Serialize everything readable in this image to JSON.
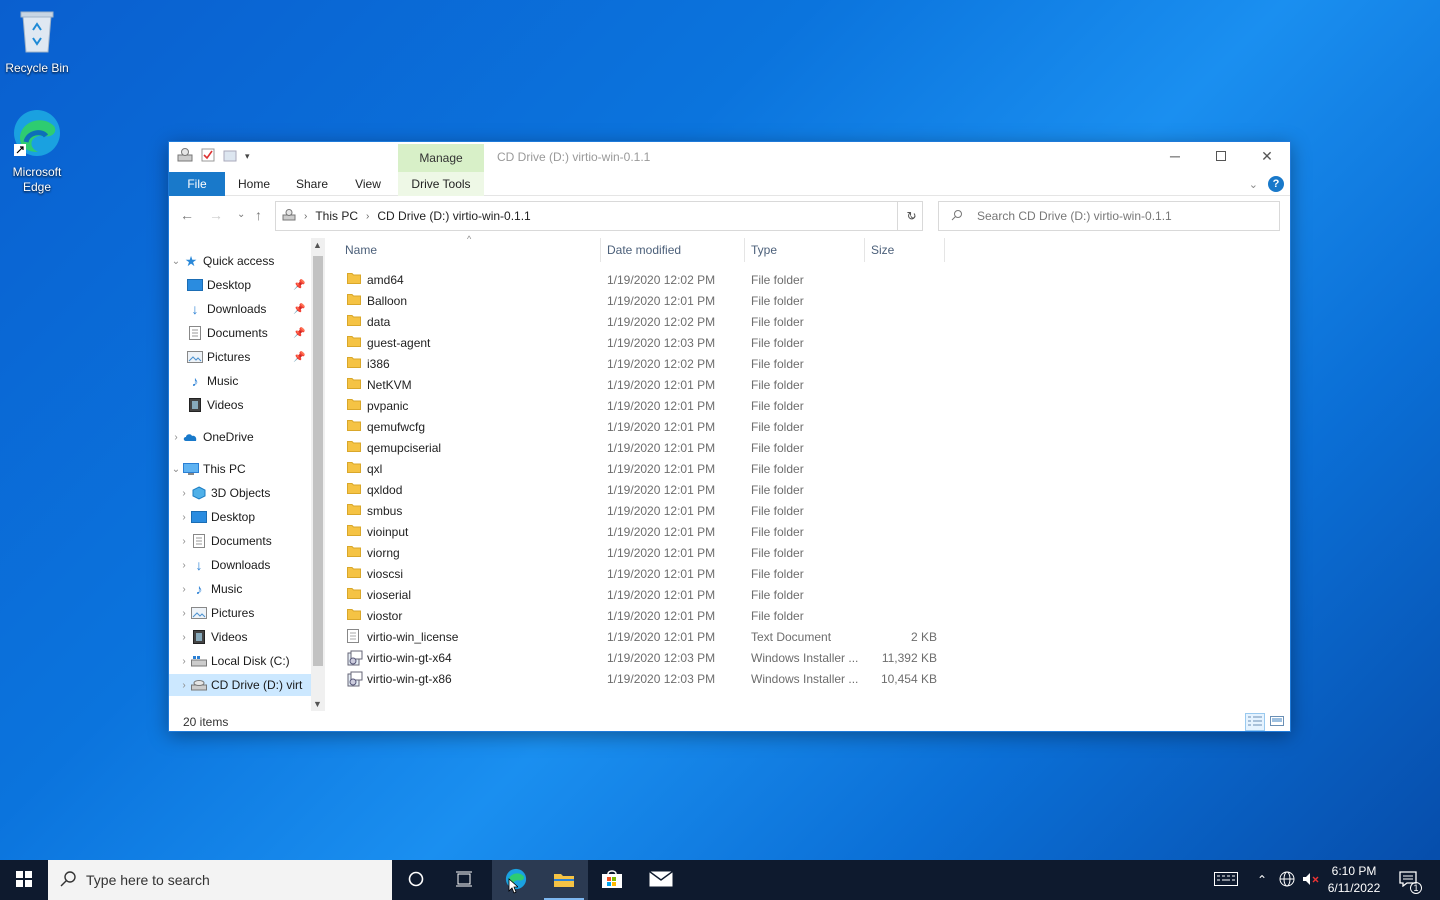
{
  "desktop": {
    "icons": [
      {
        "label": "Recycle Bin"
      },
      {
        "label_line1": "Microsoft",
        "label_line2": "Edge"
      }
    ]
  },
  "window": {
    "context_tab": "Manage",
    "title": "CD Drive (D:) virtio-win-0.1.1",
    "ribbon_tabs": {
      "file": "File",
      "home": "Home",
      "share": "Share",
      "view": "View",
      "drive_tools": "Drive Tools"
    },
    "address": {
      "crumb1": "This PC",
      "crumb2": "CD Drive (D:) virtio-win-0.1.1"
    },
    "search_placeholder": "Search CD Drive (D:) virtio-win-0.1.1",
    "columns": {
      "name": "Name",
      "date": "Date modified",
      "type": "Type",
      "size": "Size"
    },
    "nav": {
      "quick_access": "Quick access",
      "qa_items": [
        "Desktop",
        "Downloads",
        "Documents",
        "Pictures",
        "Music",
        "Videos"
      ],
      "onedrive": "OneDrive",
      "this_pc": "This PC",
      "pc_items": [
        "3D Objects",
        "Desktop",
        "Documents",
        "Downloads",
        "Music",
        "Pictures",
        "Videos",
        "Local Disk (C:)",
        "CD Drive (D:) virt"
      ]
    },
    "files": [
      {
        "name": "amd64",
        "date": "1/19/2020 12:02 PM",
        "type": "File folder",
        "size": ""
      },
      {
        "name": "Balloon",
        "date": "1/19/2020 12:01 PM",
        "type": "File folder",
        "size": ""
      },
      {
        "name": "data",
        "date": "1/19/2020 12:02 PM",
        "type": "File folder",
        "size": ""
      },
      {
        "name": "guest-agent",
        "date": "1/19/2020 12:03 PM",
        "type": "File folder",
        "size": ""
      },
      {
        "name": "i386",
        "date": "1/19/2020 12:02 PM",
        "type": "File folder",
        "size": ""
      },
      {
        "name": "NetKVM",
        "date": "1/19/2020 12:01 PM",
        "type": "File folder",
        "size": ""
      },
      {
        "name": "pvpanic",
        "date": "1/19/2020 12:01 PM",
        "type": "File folder",
        "size": ""
      },
      {
        "name": "qemufwcfg",
        "date": "1/19/2020 12:01 PM",
        "type": "File folder",
        "size": ""
      },
      {
        "name": "qemupciserial",
        "date": "1/19/2020 12:01 PM",
        "type": "File folder",
        "size": ""
      },
      {
        "name": "qxl",
        "date": "1/19/2020 12:01 PM",
        "type": "File folder",
        "size": ""
      },
      {
        "name": "qxldod",
        "date": "1/19/2020 12:01 PM",
        "type": "File folder",
        "size": ""
      },
      {
        "name": "smbus",
        "date": "1/19/2020 12:01 PM",
        "type": "File folder",
        "size": ""
      },
      {
        "name": "vioinput",
        "date": "1/19/2020 12:01 PM",
        "type": "File folder",
        "size": ""
      },
      {
        "name": "viorng",
        "date": "1/19/2020 12:01 PM",
        "type": "File folder",
        "size": ""
      },
      {
        "name": "vioscsi",
        "date": "1/19/2020 12:01 PM",
        "type": "File folder",
        "size": ""
      },
      {
        "name": "vioserial",
        "date": "1/19/2020 12:01 PM",
        "type": "File folder",
        "size": ""
      },
      {
        "name": "viostor",
        "date": "1/19/2020 12:01 PM",
        "type": "File folder",
        "size": ""
      },
      {
        "name": "virtio-win_license",
        "date": "1/19/2020 12:01 PM",
        "type": "Text Document",
        "size": "2 KB"
      },
      {
        "name": "virtio-win-gt-x64",
        "date": "1/19/2020 12:03 PM",
        "type": "Windows Installer ...",
        "size": "11,392 KB"
      },
      {
        "name": "virtio-win-gt-x86",
        "date": "1/19/2020 12:03 PM",
        "type": "Windows Installer ...",
        "size": "10,454 KB"
      }
    ],
    "status": "20 items"
  },
  "taskbar": {
    "search_placeholder": "Type here to search",
    "time": "6:10 PM",
    "date": "6/11/2022",
    "notification_count": "1"
  },
  "colors": {
    "accent": "#1979ca",
    "folder": "#f5c344",
    "manage_tab": "#d8f0c8",
    "taskbar": "#0e1a2e"
  }
}
